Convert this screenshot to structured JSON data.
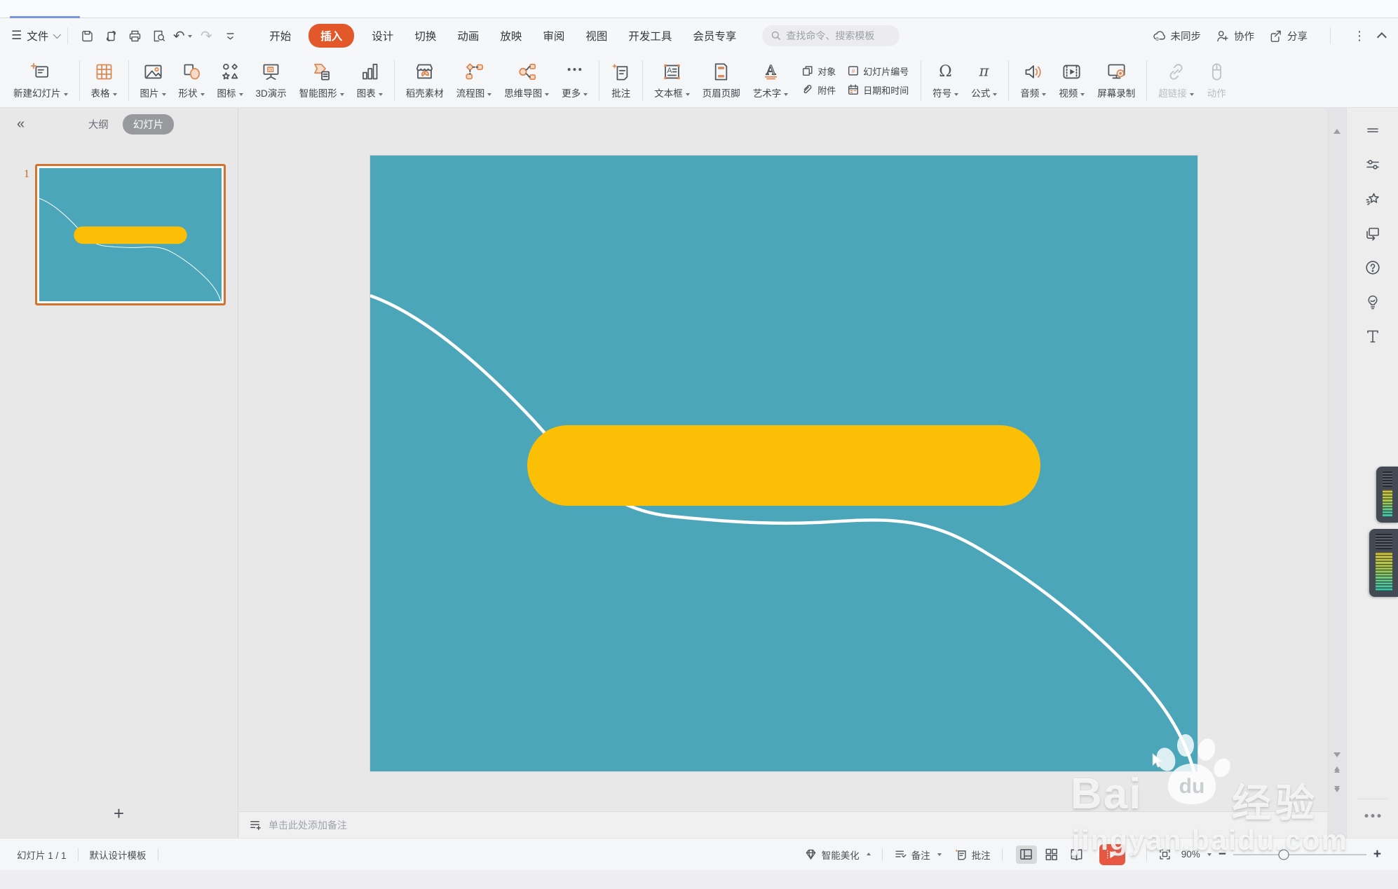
{
  "window": {
    "sync_label": "未同步",
    "collab_label": "协作",
    "share_label": "分享"
  },
  "menu": {
    "file_label": "文件",
    "tabs": [
      "开始",
      "插入",
      "设计",
      "切换",
      "动画",
      "放映",
      "审阅",
      "视图",
      "开发工具",
      "会员专享"
    ],
    "active_tab": "插入",
    "search_placeholder": "查找命令、搜索模板"
  },
  "icons": {
    "quick_access": [
      "save",
      "output",
      "print",
      "print-preview",
      "undo",
      "redo",
      "more-commands"
    ],
    "window_icons": [
      "cloud-sync",
      "collaborate",
      "share",
      "more-vertical",
      "collapse-ribbon"
    ],
    "sidebar_icons": [
      "panel-handle",
      "object-properties",
      "creative-effects",
      "switch-display",
      "help",
      "tips-bulb",
      "text-tool",
      "more-dots"
    ]
  },
  "toolbar": {
    "items": [
      "新建幻灯片",
      "表格",
      "图片",
      "形状",
      "图标",
      "3D演示",
      "智能图形",
      "图表",
      "稻壳素材",
      "流程图",
      "思维导图",
      "更多",
      "批注",
      "文本框",
      "页眉页脚",
      "艺术字",
      "符号",
      "公式",
      "音频",
      "视频",
      "屏幕录制",
      "超链接",
      "动作"
    ],
    "small_items": [
      "对象",
      "附件",
      "幻灯片编号",
      "日期和时间"
    ]
  },
  "panel": {
    "collapse_glyph": "«",
    "tab_outline": "大纲",
    "tab_slides": "幻灯片",
    "slide_number": "1"
  },
  "notes": {
    "placeholder": "单击此处添加备注"
  },
  "status": {
    "slide_counter": "幻灯片 1 / 1",
    "template_name": "默认设计模板",
    "beautify_label": "智能美化",
    "notes_label": "备注",
    "comments_label": "批注",
    "zoom_level": "90%",
    "zoom_percent": 90
  },
  "slide_content": {
    "shapes": [
      "rounded-rectangle-yellow",
      "freeform-white-curve"
    ],
    "slide_count": 1
  },
  "watermark": {
    "brand_left": "Bai",
    "brand_center": "du",
    "brand_right": "经验",
    "url": "jingyan.baidu.com"
  },
  "colors": {
    "slide_bg": "#4BA6BA",
    "shape_yellow": "#FBBF05",
    "curve_white": "#FFFFFF",
    "accent_orange": "#E2582B",
    "thumb_selection": "#D4722F",
    "play_button": "#E85742"
  }
}
